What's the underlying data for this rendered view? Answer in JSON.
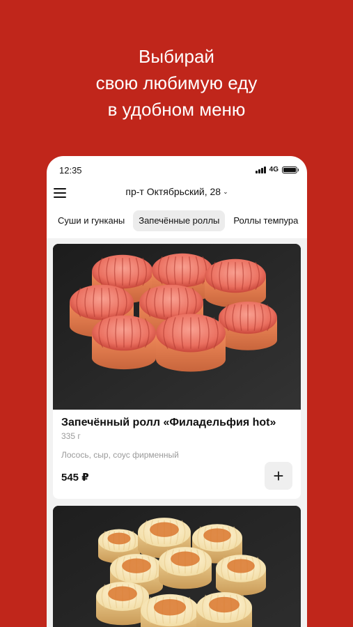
{
  "promo": {
    "line1": "Выбирай",
    "line2": "свою любимую еду",
    "line3": "в удобном меню"
  },
  "status_bar": {
    "time": "12:35",
    "network": "4G"
  },
  "header": {
    "address": "пр-т Октябрьский, 28",
    "menu_icon": "hamburger-menu-icon"
  },
  "tabs": [
    {
      "label": "Суши и гунканы",
      "active": false
    },
    {
      "label": "Запечённые роллы",
      "active": true
    },
    {
      "label": "Роллы темпура",
      "active": false
    }
  ],
  "products": [
    {
      "name": "Запечённый ролл «Филадельфия hot»",
      "weight": "335 г",
      "description": "Лосось, сыр, соус фирменный",
      "price": "545 ₽",
      "add_icon": "plus-icon"
    }
  ],
  "colors": {
    "brand_red": "#c0261b",
    "slate": "#222222"
  }
}
